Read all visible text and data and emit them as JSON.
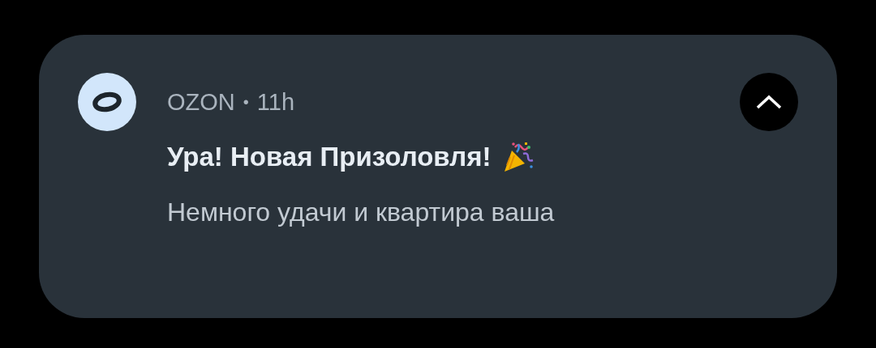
{
  "notification": {
    "app_name": "OZON",
    "separator": "•",
    "time": "11h",
    "title": "Ура! Новая Призоловля!",
    "body": "Немного удачи и квартира ваша",
    "expanded": true
  }
}
